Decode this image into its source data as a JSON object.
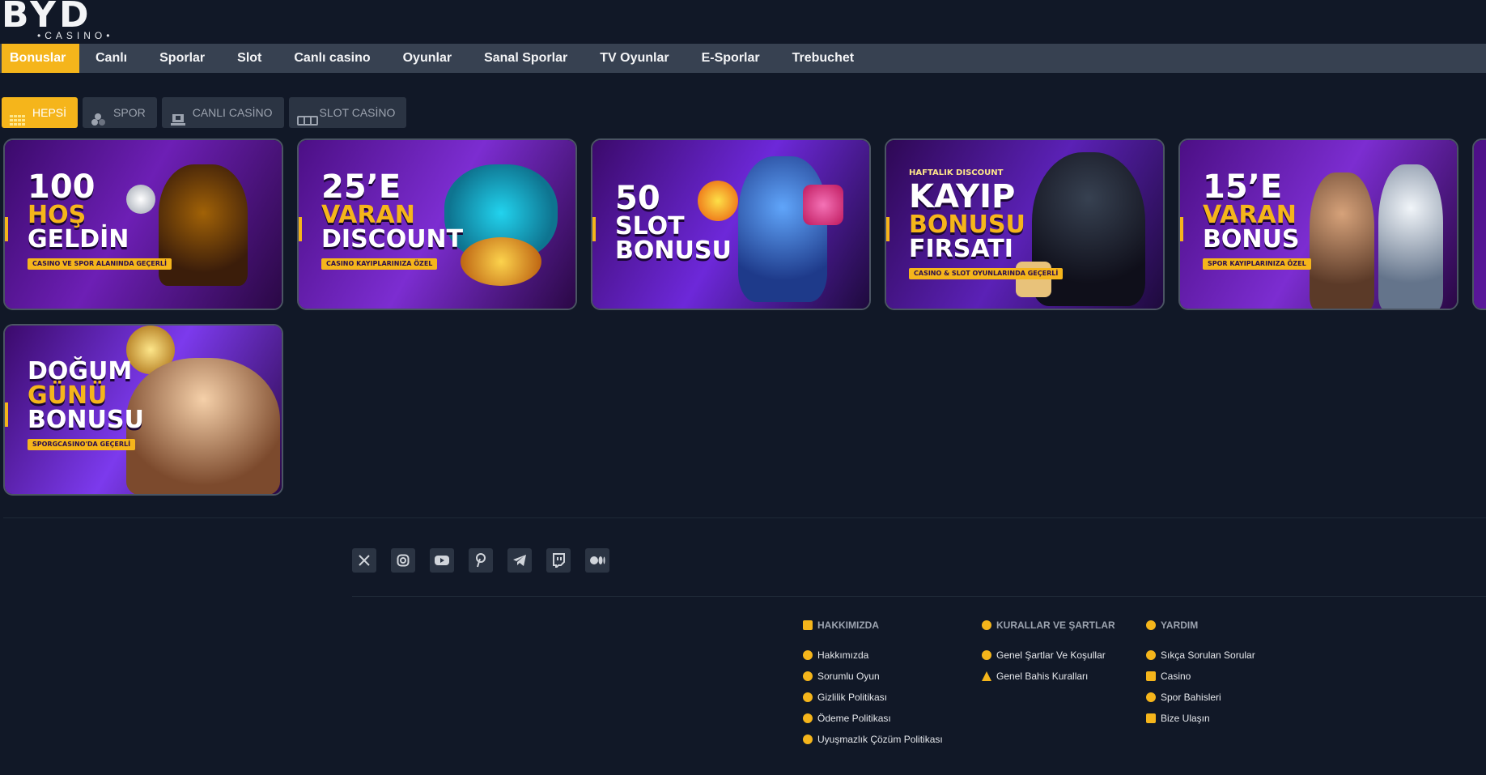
{
  "logo": {
    "text": "BYD",
    "sub": "•CASINO•"
  },
  "nav": [
    "Bonuslar",
    "Canlı",
    "Sporlar",
    "Slot",
    "Canlı casino",
    "Oyunlar",
    "Sanal Sporlar",
    "TV Oyunlar",
    "E-Sporlar",
    "Trebuchet"
  ],
  "filters": [
    "HEPSİ",
    "SPOR",
    "CANLI CASİNO",
    "SLOT CASİNO"
  ],
  "cards": [
    {
      "l1": "100",
      "l2": "HOŞ",
      "l3": "GELDİN",
      "small": "CASINO VE SPOR ALANINDA GEÇERLİ",
      "pre": ""
    },
    {
      "l1": "25’E",
      "l2": "VARAN",
      "l3": "DISCOUNT",
      "small": "CASINO KAYIPLARINIZA ÖZEL",
      "pre": ""
    },
    {
      "l1": "50",
      "l2": "SLOT",
      "l3": "BONUSU",
      "small": "",
      "pre": ""
    },
    {
      "l1": "KAYIP",
      "l2": "BONUSU",
      "l3": "FIRSATI",
      "small": "CASINO & SLOT OYUNLARINDA GEÇERLİ",
      "pre": "HAFTALIK DISCOUNT"
    },
    {
      "l1": "15’E",
      "l2": "VARAN",
      "l3": "BONUS",
      "small": "SPOR KAYIPLARINIZA ÖZEL",
      "pre": ""
    },
    {
      "l1": "DOĞUM",
      "l2": "GÜNÜ",
      "l3": "BONUSU",
      "small": "SPORGCASINO'DA GEÇERLİ",
      "pre": ""
    }
  ],
  "social_icons": [
    "x-icon",
    "instagram-icon",
    "youtube-icon",
    "pinterest-icon",
    "telegram-icon",
    "twitch-icon",
    "medium-icon"
  ],
  "footer": {
    "about": {
      "title": "HAKKIMIZDA",
      "links": [
        "Hakkımızda",
        "Sorumlu Oyun",
        "Gizlilik Politikası",
        "Ödeme Politikası",
        "Uyuşmazlık Çözüm Politikası"
      ]
    },
    "rules": {
      "title": "KURALLAR VE ŞARTLAR",
      "links": [
        "Genel Şartlar Ve Koşullar",
        "Genel Bahis Kuralları"
      ]
    },
    "help": {
      "title": "YARDIM",
      "links": [
        "Sıkça Sorulan Sorular",
        "Casino",
        "Spor Bahisleri",
        "Bize Ulaşın"
      ]
    }
  },
  "colors": {
    "accent": "#f5b51b",
    "nav_bg": "#374151",
    "page_bg": "#111827"
  }
}
